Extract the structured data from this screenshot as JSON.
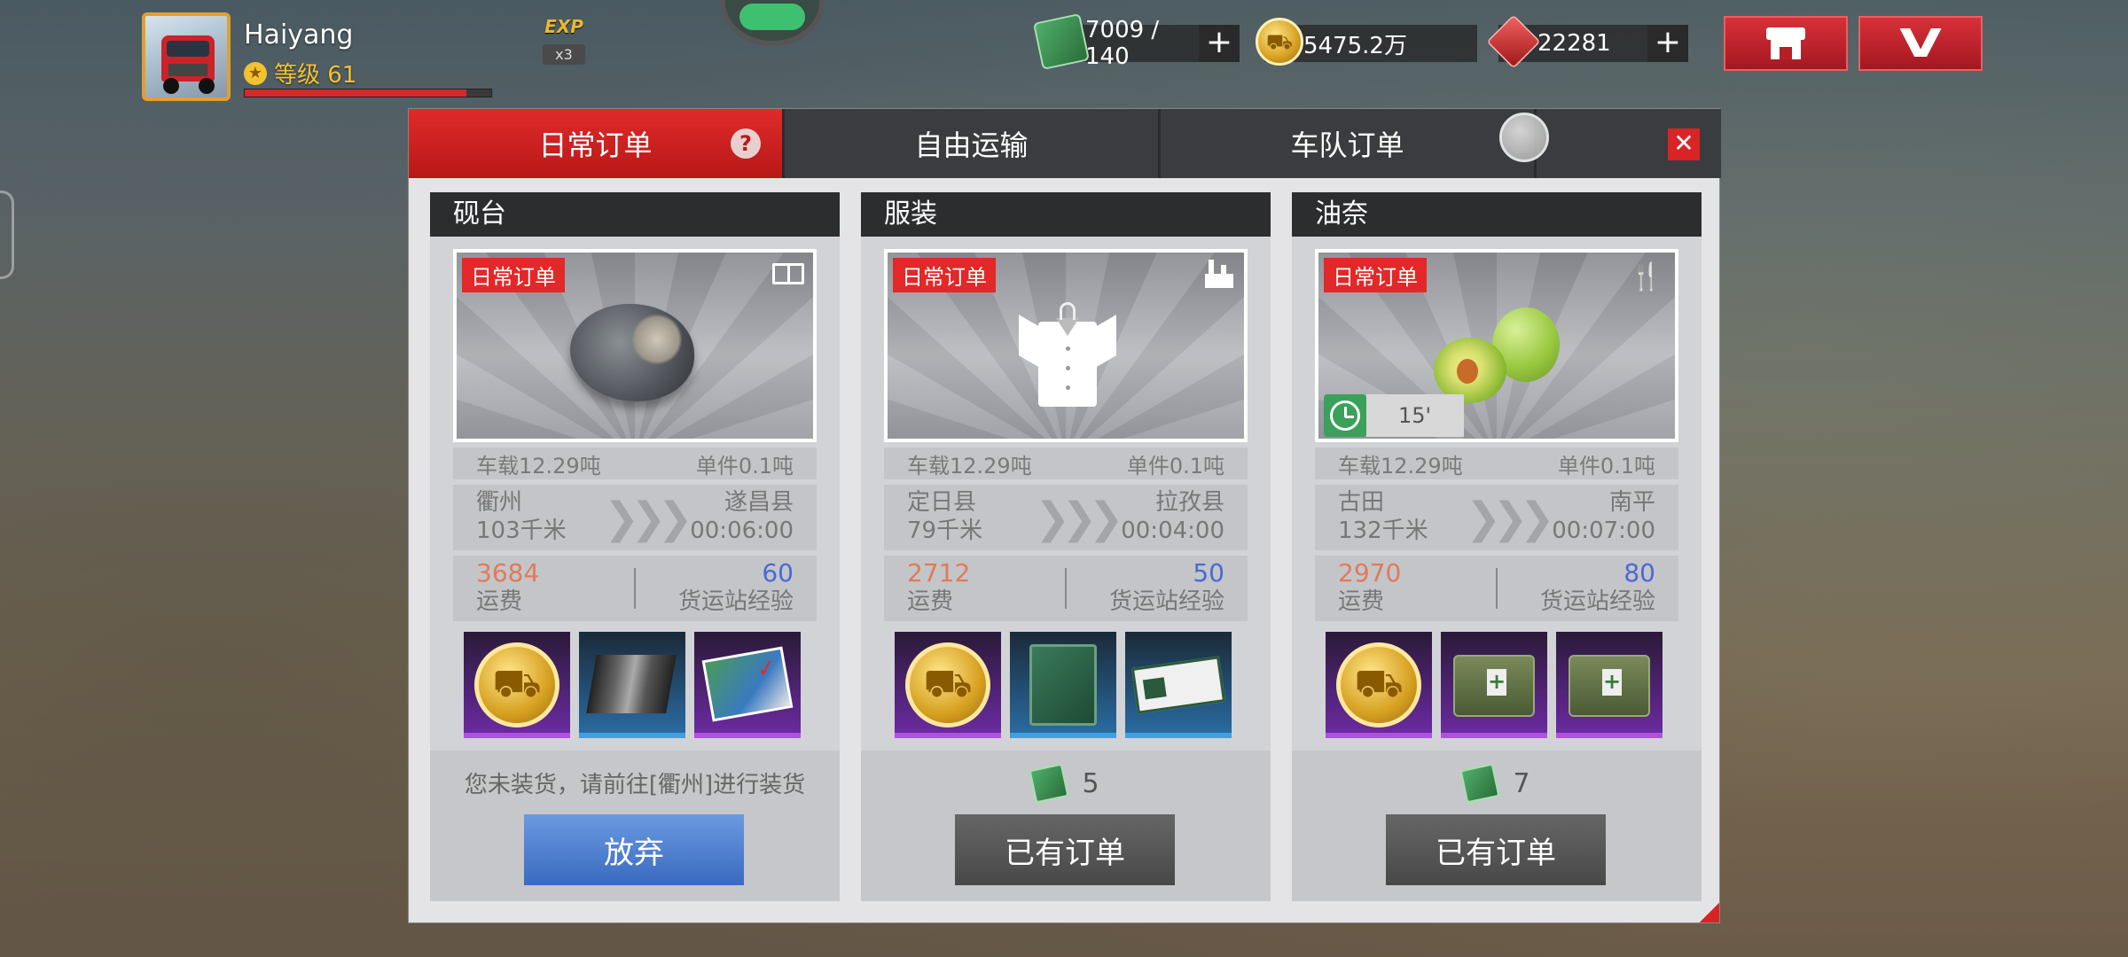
{
  "player": {
    "name": "Haiyang",
    "level_label": "等级 61",
    "xp_fraction": 0.9
  },
  "exp_badge": {
    "label": "EXP",
    "multiplier": "x3"
  },
  "resources": {
    "tickets": "7009 / 140",
    "coins": "5475.2万",
    "gems": "22281",
    "plus": "+"
  },
  "tabs": [
    {
      "label": "日常订单",
      "active": true
    },
    {
      "label": "自由运输",
      "active": false
    },
    {
      "label": "车队订单",
      "active": false
    }
  ],
  "help_glyph": "?",
  "close_glyph": "✕",
  "cards": [
    {
      "title": "砚台",
      "tag": "日常订单",
      "category_icon": "book-icon",
      "load": "车载12.29吨",
      "unit": "单件0.1吨",
      "from": "衢州",
      "distance": "103千米",
      "to": "遂昌县",
      "time": "00:06:00",
      "pay": "3684",
      "pay_label": "运费",
      "exp": "60",
      "exp_label": "货运站经验",
      "rewards": [
        "coin-reward-icon",
        "fabric-reward-icon",
        "map-reward-icon"
      ],
      "footer_message": "您未装货，请前往[衢州]进行装货",
      "action": "放弃"
    },
    {
      "title": "服装",
      "tag": "日常订单",
      "category_icon": "factory-icon",
      "load": "车载12.29吨",
      "unit": "单件0.1吨",
      "from": "定日县",
      "distance": "79千米",
      "to": "拉孜县",
      "time": "00:04:00",
      "pay": "2712",
      "pay_label": "运费",
      "exp": "50",
      "exp_label": "货运站经验",
      "rewards": [
        "coin-reward-icon",
        "book-reward-icon",
        "ticket-reward-icon"
      ],
      "cost": "5",
      "action": "已有订单"
    },
    {
      "title": "油奈",
      "tag": "日常订单",
      "category_icon": "fork-icon",
      "timer": "15'",
      "load": "车载12.29吨",
      "unit": "单件0.1吨",
      "from": "古田",
      "distance": "132千米",
      "to": "南平",
      "time": "00:07:00",
      "pay": "2970",
      "pay_label": "运费",
      "exp": "80",
      "exp_label": "货运站经验",
      "rewards": [
        "coin-reward-icon",
        "kit-reward-icon",
        "kit-reward-icon"
      ],
      "cost": "7",
      "action": "已有订单"
    }
  ],
  "colors": {
    "accent_red": "#e02a2a",
    "pay_orange": "#e07a5a",
    "exp_blue": "#4a6ad0",
    "level_gold": "#f2c230"
  }
}
